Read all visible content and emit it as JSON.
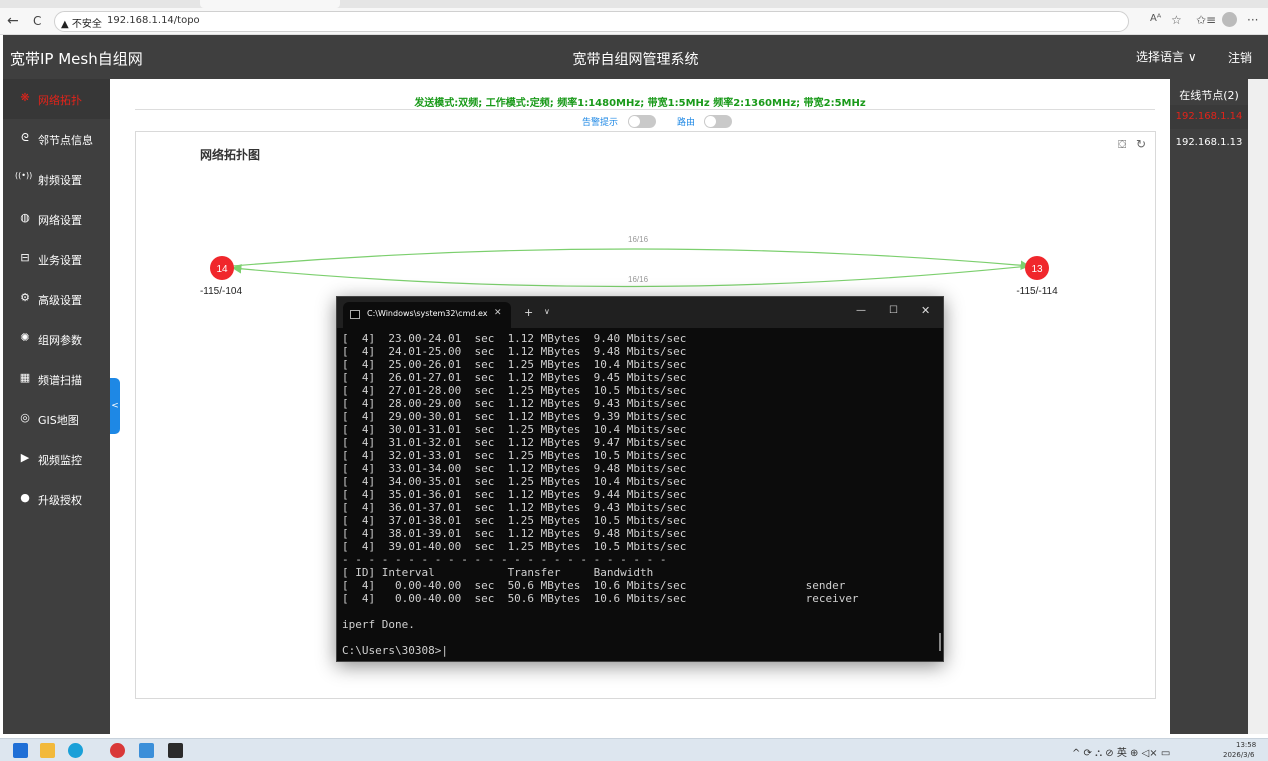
{
  "browser": {
    "back": "←",
    "refresh": "C",
    "security_warning": "▲ 不安全",
    "url": "192.168.1.14/topo",
    "read_aloud": "Aᴬ",
    "favorite": "☆",
    "collections": "✩≡",
    "more": "···"
  },
  "header": {
    "app_title": "宽带IP Mesh自组网",
    "system_title": "宽带自组网管理系统",
    "language_button": "选择语言 ∨",
    "logout_button": "注销"
  },
  "sidebar": {
    "items": [
      {
        "label": "网络拓扑",
        "icon": "❋",
        "active": true
      },
      {
        "label": "邻节点信息",
        "icon": "ᘓ"
      },
      {
        "label": "射频设置",
        "icon": "((•))"
      },
      {
        "label": "网络设置",
        "icon": "◍"
      },
      {
        "label": "业务设置",
        "icon": "⊟"
      },
      {
        "label": "高级设置",
        "icon": "⚙"
      },
      {
        "label": "组网参数",
        "icon": "✺"
      },
      {
        "label": "频谱扫描",
        "icon": "▦"
      },
      {
        "label": "GIS地图",
        "icon": "◎"
      },
      {
        "label": "视频监控",
        "icon": "▶"
      },
      {
        "label": "升级授权",
        "icon": "●"
      }
    ],
    "collapse_arrow": "<"
  },
  "main": {
    "status_line": "发送模式:双频; 工作模式:定频; 频率1:1480MHz; 带宽1:5MHz 频率2:1360MHz; 带宽2:5MHz",
    "alarm_label": "告警提示",
    "route_label": "路由",
    "alarm_on": false,
    "route_on": false,
    "topology": {
      "title": "网络拓扑图",
      "download_icon": "⛋",
      "refresh_icon": "↻",
      "nodes": [
        {
          "id": "14",
          "signal": "-115/-104"
        },
        {
          "id": "13",
          "signal": "-115/-114"
        }
      ],
      "links": [
        {
          "label": "16/16"
        },
        {
          "label": "16/16"
        }
      ],
      "node_color": "#f0272c",
      "link_color": "#7ccf6e"
    }
  },
  "online_nodes": {
    "title": "在线节点(2)",
    "items": [
      "192.168.1.14",
      "192.168.1.13"
    ]
  },
  "terminal": {
    "tab_title": "C:\\Windows\\system32\\cmd.ex",
    "tab_close": "✕",
    "new_tab": "+",
    "dropdown": "∨",
    "minimize": "—",
    "maximize": "☐",
    "close": "✕",
    "lines": [
      "[  4]  23.00-24.01  sec  1.12 MBytes  9.40 Mbits/sec",
      "[  4]  24.01-25.00  sec  1.12 MBytes  9.48 Mbits/sec",
      "[  4]  25.00-26.01  sec  1.25 MBytes  10.4 Mbits/sec",
      "[  4]  26.01-27.01  sec  1.12 MBytes  9.45 Mbits/sec",
      "[  4]  27.01-28.00  sec  1.25 MBytes  10.5 Mbits/sec",
      "[  4]  28.00-29.00  sec  1.12 MBytes  9.43 Mbits/sec",
      "[  4]  29.00-30.01  sec  1.12 MBytes  9.39 Mbits/sec",
      "[  4]  30.01-31.01  sec  1.25 MBytes  10.4 Mbits/sec",
      "[  4]  31.01-32.01  sec  1.12 MBytes  9.47 Mbits/sec",
      "[  4]  32.01-33.01  sec  1.25 MBytes  10.5 Mbits/sec",
      "[  4]  33.01-34.00  sec  1.12 MBytes  9.48 Mbits/sec",
      "[  4]  34.00-35.01  sec  1.25 MBytes  10.4 Mbits/sec",
      "[  4]  35.01-36.01  sec  1.12 MBytes  9.44 Mbits/sec",
      "[  4]  36.01-37.01  sec  1.12 MBytes  9.43 Mbits/sec",
      "[  4]  37.01-38.01  sec  1.25 MBytes  10.5 Mbits/sec",
      "[  4]  38.01-39.01  sec  1.12 MBytes  9.48 Mbits/sec",
      "[  4]  39.01-40.00  sec  1.25 MBytes  10.5 Mbits/sec",
      "- - - - - - - - - - - - - - - - - - - - - - - - -",
      "[ ID] Interval           Transfer     Bandwidth",
      "[  4]   0.00-40.00  sec  50.6 MBytes  10.6 Mbits/sec                  sender",
      "[  4]   0.00-40.00  sec  50.6 MBytes  10.6 Mbits/sec                  receiver",
      "",
      "iperf Done.",
      "",
      "C:\\Users\\30308>|"
    ]
  },
  "taskbar": {
    "tray": "^ ⟳ ⛬ ⊘ 英 ⊕ ◁× ▭",
    "time": "13:58",
    "date": "2026/3/6"
  },
  "colors": {
    "header_bg": "#3f3f3f",
    "accent_red": "#e2231a",
    "status_green": "#1a9a1a",
    "link_blue": "#1e88e5"
  }
}
